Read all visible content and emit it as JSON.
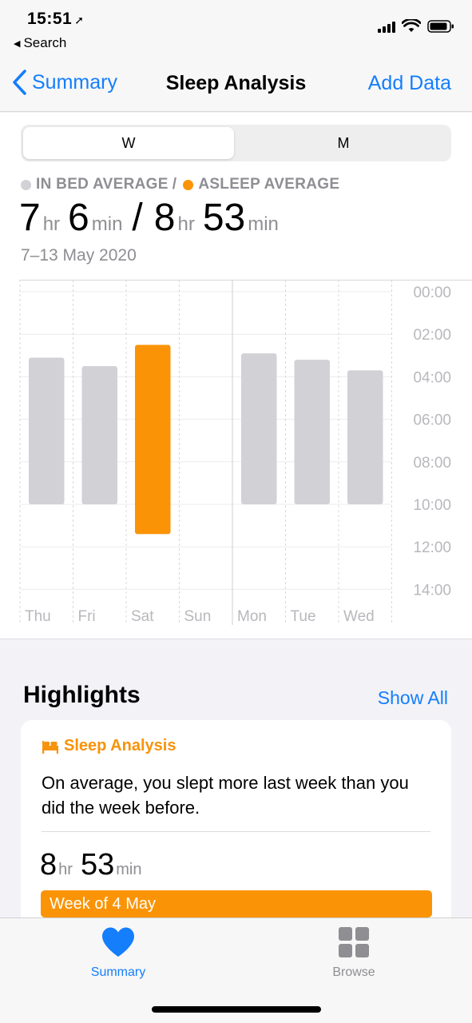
{
  "status_bar": {
    "time": "15:51",
    "back_app": "Search"
  },
  "nav": {
    "back_label": "Summary",
    "title": "Sleep Analysis",
    "action_label": "Add Data"
  },
  "segments": [
    "W",
    "M"
  ],
  "legend": {
    "in_bed": "IN BED AVERAGE",
    "separator": "/",
    "asleep": "ASLEEP AVERAGE"
  },
  "colors": {
    "accent": "#147efb",
    "in_bed": "#d1d1d6",
    "asleep": "#fa9406"
  },
  "summary": {
    "in_bed_hr": "7",
    "in_bed_min": "6",
    "asleep_hr": "8",
    "asleep_min": "53",
    "hr_unit": "hr",
    "min_unit": "min",
    "slash": "/",
    "date_range": "7–13 May 2020"
  },
  "chart_data": {
    "type": "bar",
    "categories": [
      "Thu",
      "Fri",
      "Sat",
      "Sun",
      "Mon",
      "Tue",
      "Wed"
    ],
    "y_ticks": [
      "00:00",
      "02:00",
      "04:00",
      "06:00",
      "08:00",
      "10:00",
      "12:00",
      "14:00"
    ],
    "ylim": [
      0,
      14
    ],
    "y_reversed": true,
    "series": [
      {
        "values": [
          [
            3.1,
            10.0
          ],
          [
            3.5,
            10.0
          ],
          null,
          null,
          [
            2.9,
            10.0
          ],
          [
            3.2,
            10.0
          ],
          [
            3.7,
            10.0
          ]
        ],
        "color": "#d1d1d6"
      },
      {
        "values": [
          null,
          null,
          [
            2.5,
            11.4
          ],
          null,
          null,
          null,
          null
        ],
        "color": "#fa9406"
      }
    ]
  },
  "highlights": {
    "title": "Highlights",
    "show_all": "Show All",
    "card": {
      "category": "Sleep Analysis",
      "text": "On average, you slept more last week than you did the week before.",
      "hr": "8",
      "hr_unit": "hr",
      "min": "53",
      "min_unit": "min",
      "bar_label": "Week of 4 May"
    }
  },
  "tabbar": {
    "summary": "Summary",
    "browse": "Browse"
  }
}
